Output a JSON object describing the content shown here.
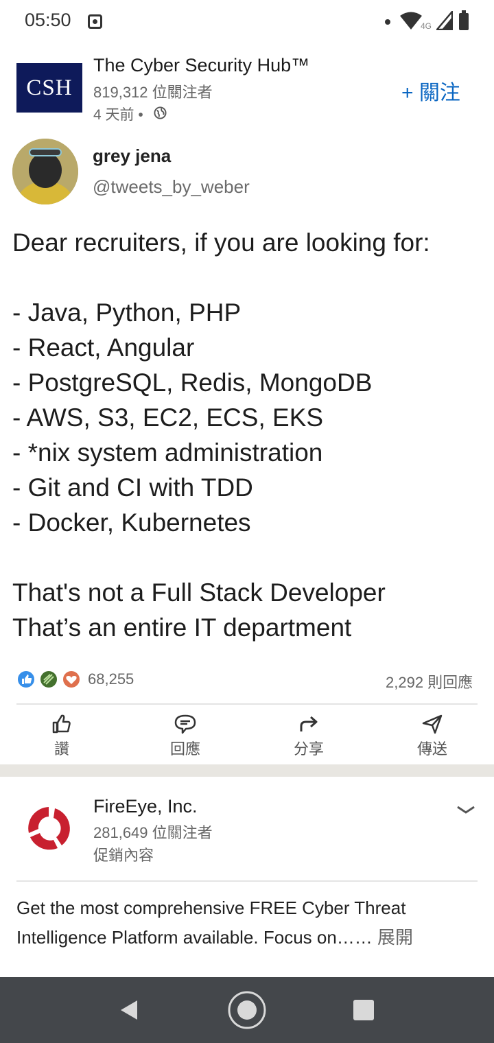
{
  "status_bar": {
    "time": "05:50",
    "network": "4G"
  },
  "post": {
    "org_name": "The Cyber Security Hub™",
    "logo_text": "CSH",
    "followers": "819,312 位關注者",
    "time_ago": "4 天前 •",
    "follow_label": "+ 關注"
  },
  "tweet": {
    "name": "grey jena",
    "handle": "@tweets_by_weber",
    "text": "Dear recruiters, if you are looking for:\n\n- Java, Python, PHP\n- React, Angular\n- PostgreSQL, Redis, MongoDB\n- AWS, S3, EC2, ECS, EKS\n- *nix system administration\n- Git and CI with TDD\n- Docker, Kubernetes\n\nThat's not a Full Stack Developer\nThat’s an entire IT department"
  },
  "reactions": {
    "count": "68,255",
    "comments": "2,292 則回應"
  },
  "actions": {
    "like": "讚",
    "comment": "回應",
    "share": "分享",
    "send": "傳送"
  },
  "promoted": {
    "name": "FireEye, Inc.",
    "followers": "281,649 位關注者",
    "label": "促銷內容",
    "text": "Get the most comprehensive FREE Cyber Threat Intelligence Platform available. Focus on……",
    "more": " 展開"
  },
  "colors": {
    "accent": "#0a66c2",
    "logo_bg": "#0e1a5a",
    "fireeye_red": "#c8202f",
    "nav_bg": "#44474b"
  }
}
